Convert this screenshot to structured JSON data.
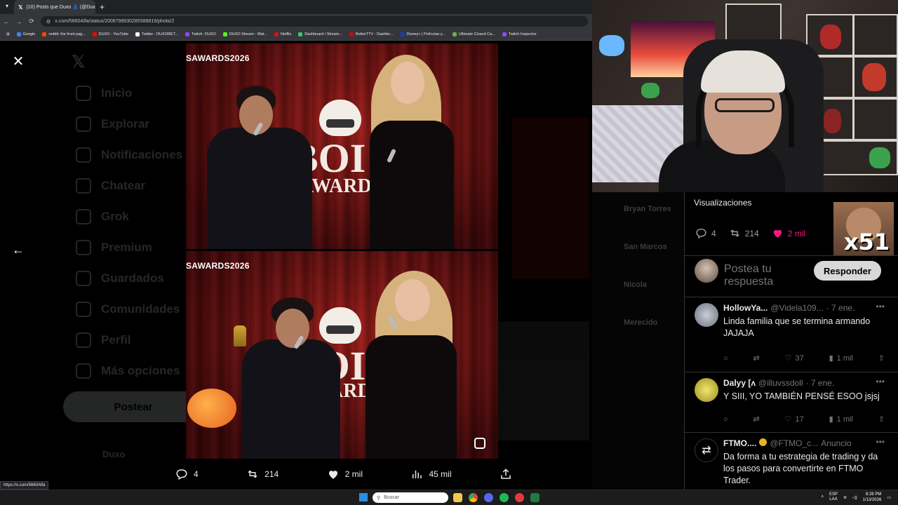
{
  "browser": {
    "tab_title": "(10) Posts que Duxo 👗 (@Dux",
    "url": "x.com/5660Alfa/status/2008798930285588819/photo/2",
    "bookmarks": [
      "Google",
      "reddit: the front pag...",
      "DUXO - YouTube",
      "Twitter - DUXORET...",
      "Twitch- DUXO",
      "DUXO Stream - Wat...",
      "Netflix",
      "Dashboard / Stream...",
      "BetterTTV - Dashbo...",
      "Disney+ | Películas y...",
      "Ultimate Closed Ca...",
      "Twitch Inspector"
    ],
    "status_url": "https://x.com/5660Alfa"
  },
  "sidebar": {
    "items": [
      "Inicio",
      "Explorar",
      "Notificaciones",
      "Chatear",
      "Grok",
      "Premium",
      "Guardados",
      "Comunidades",
      "Perfil",
      "Más opciones"
    ],
    "post_button": "Postear",
    "profile_name": "Duxo"
  },
  "photos": {
    "label_top": "SAWARDS2026",
    "label_bottom": "SAWARDS2026",
    "sign_1": "BOI",
    "sign_2": "AWARDS"
  },
  "media_actions": {
    "replies": "4",
    "reposts": "214",
    "likes": "2 mil",
    "views": "45 mil"
  },
  "side_ghost": [
    "Bryan Torres",
    "San Marcos",
    "Nicola",
    "Merecido"
  ],
  "tweet_panel": {
    "views_label": "Visualizaciones",
    "replies": "4",
    "reposts": "214",
    "likes": "2 mil",
    "reply_placeholder": "Postea tu respuesta",
    "reply_button": "Responder",
    "overlay_badge": "x51"
  },
  "comments": [
    {
      "name": "HollowYa...",
      "handle": "@Videla109...",
      "time": "· 7 ene.",
      "text": "Linda familia que se termina armando JAJAJA",
      "likes": "37",
      "views": "1 mil"
    },
    {
      "name": "Dalyy [ʌ",
      "handle": "@illuvssdoll",
      "time": "· 7 ene.",
      "text": "Y SIII, YO TAMBIÉN PENSÉ ESOO jsjsj",
      "likes": "17",
      "views": "1 mil"
    },
    {
      "name": "FTMO....",
      "handle": "@FTMO_c...",
      "time": "Anuncio",
      "text": "Da forma a tu estrategia de trading y da los pasos para convertirte en FTMO Trader."
    }
  ],
  "taskbar": {
    "search_placeholder": "Buscar",
    "lang": "ESP",
    "lang2": "LAA",
    "time": "8:28 PM",
    "date": "1/13/2026"
  },
  "colors": {
    "like_pink": "#f91880",
    "x_bg": "#000000",
    "muted": "#71767b"
  }
}
